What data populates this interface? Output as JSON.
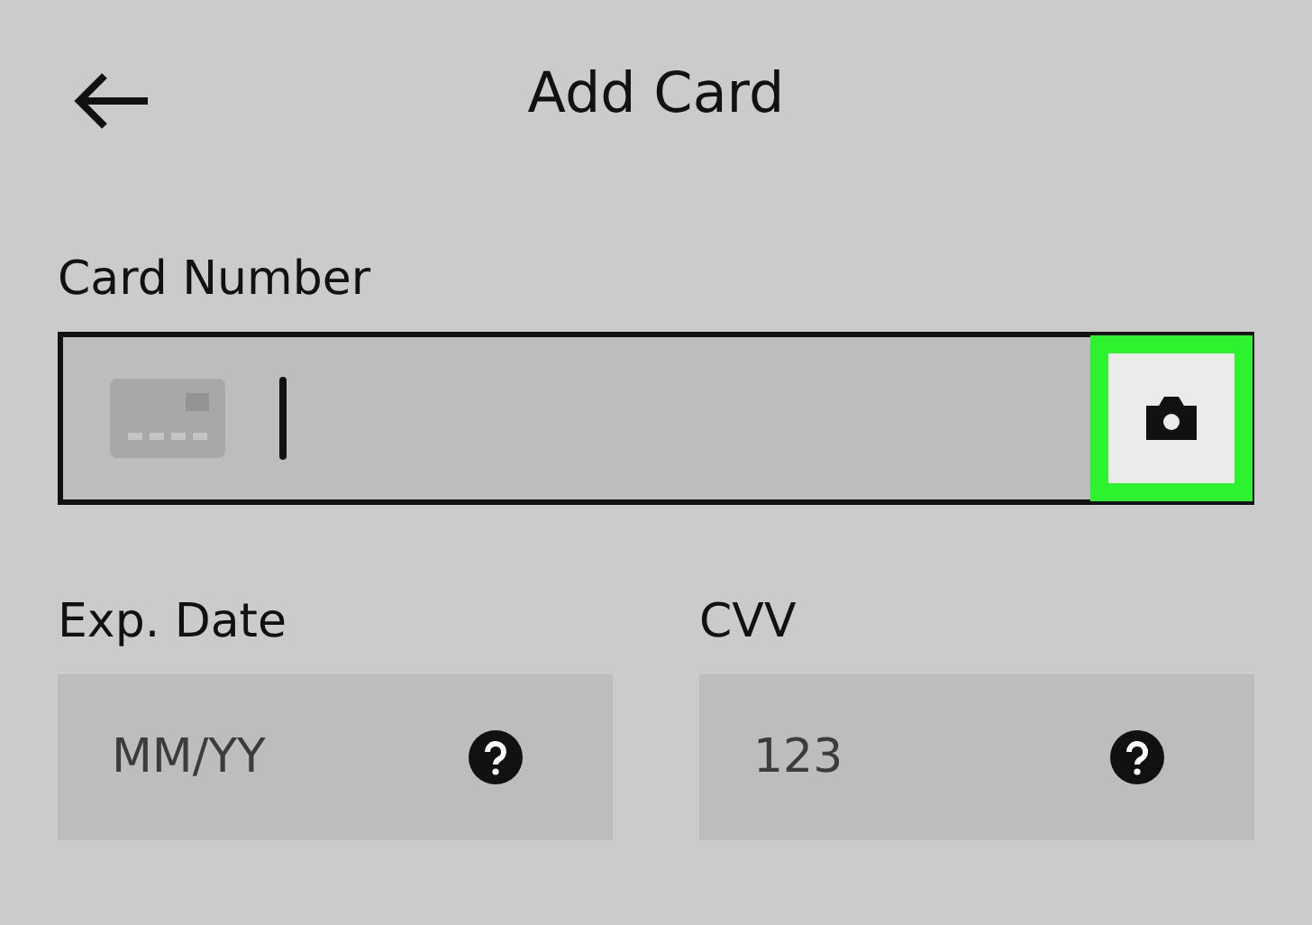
{
  "header": {
    "title": "Add Card"
  },
  "card_number": {
    "label": "Card Number",
    "focused": true,
    "scan_button": {
      "highlighted": true
    }
  },
  "fields": [
    {
      "label": "Exp. Date",
      "placeholder": "MM/YY"
    },
    {
      "label": "CVV",
      "placeholder": "123"
    }
  ]
}
